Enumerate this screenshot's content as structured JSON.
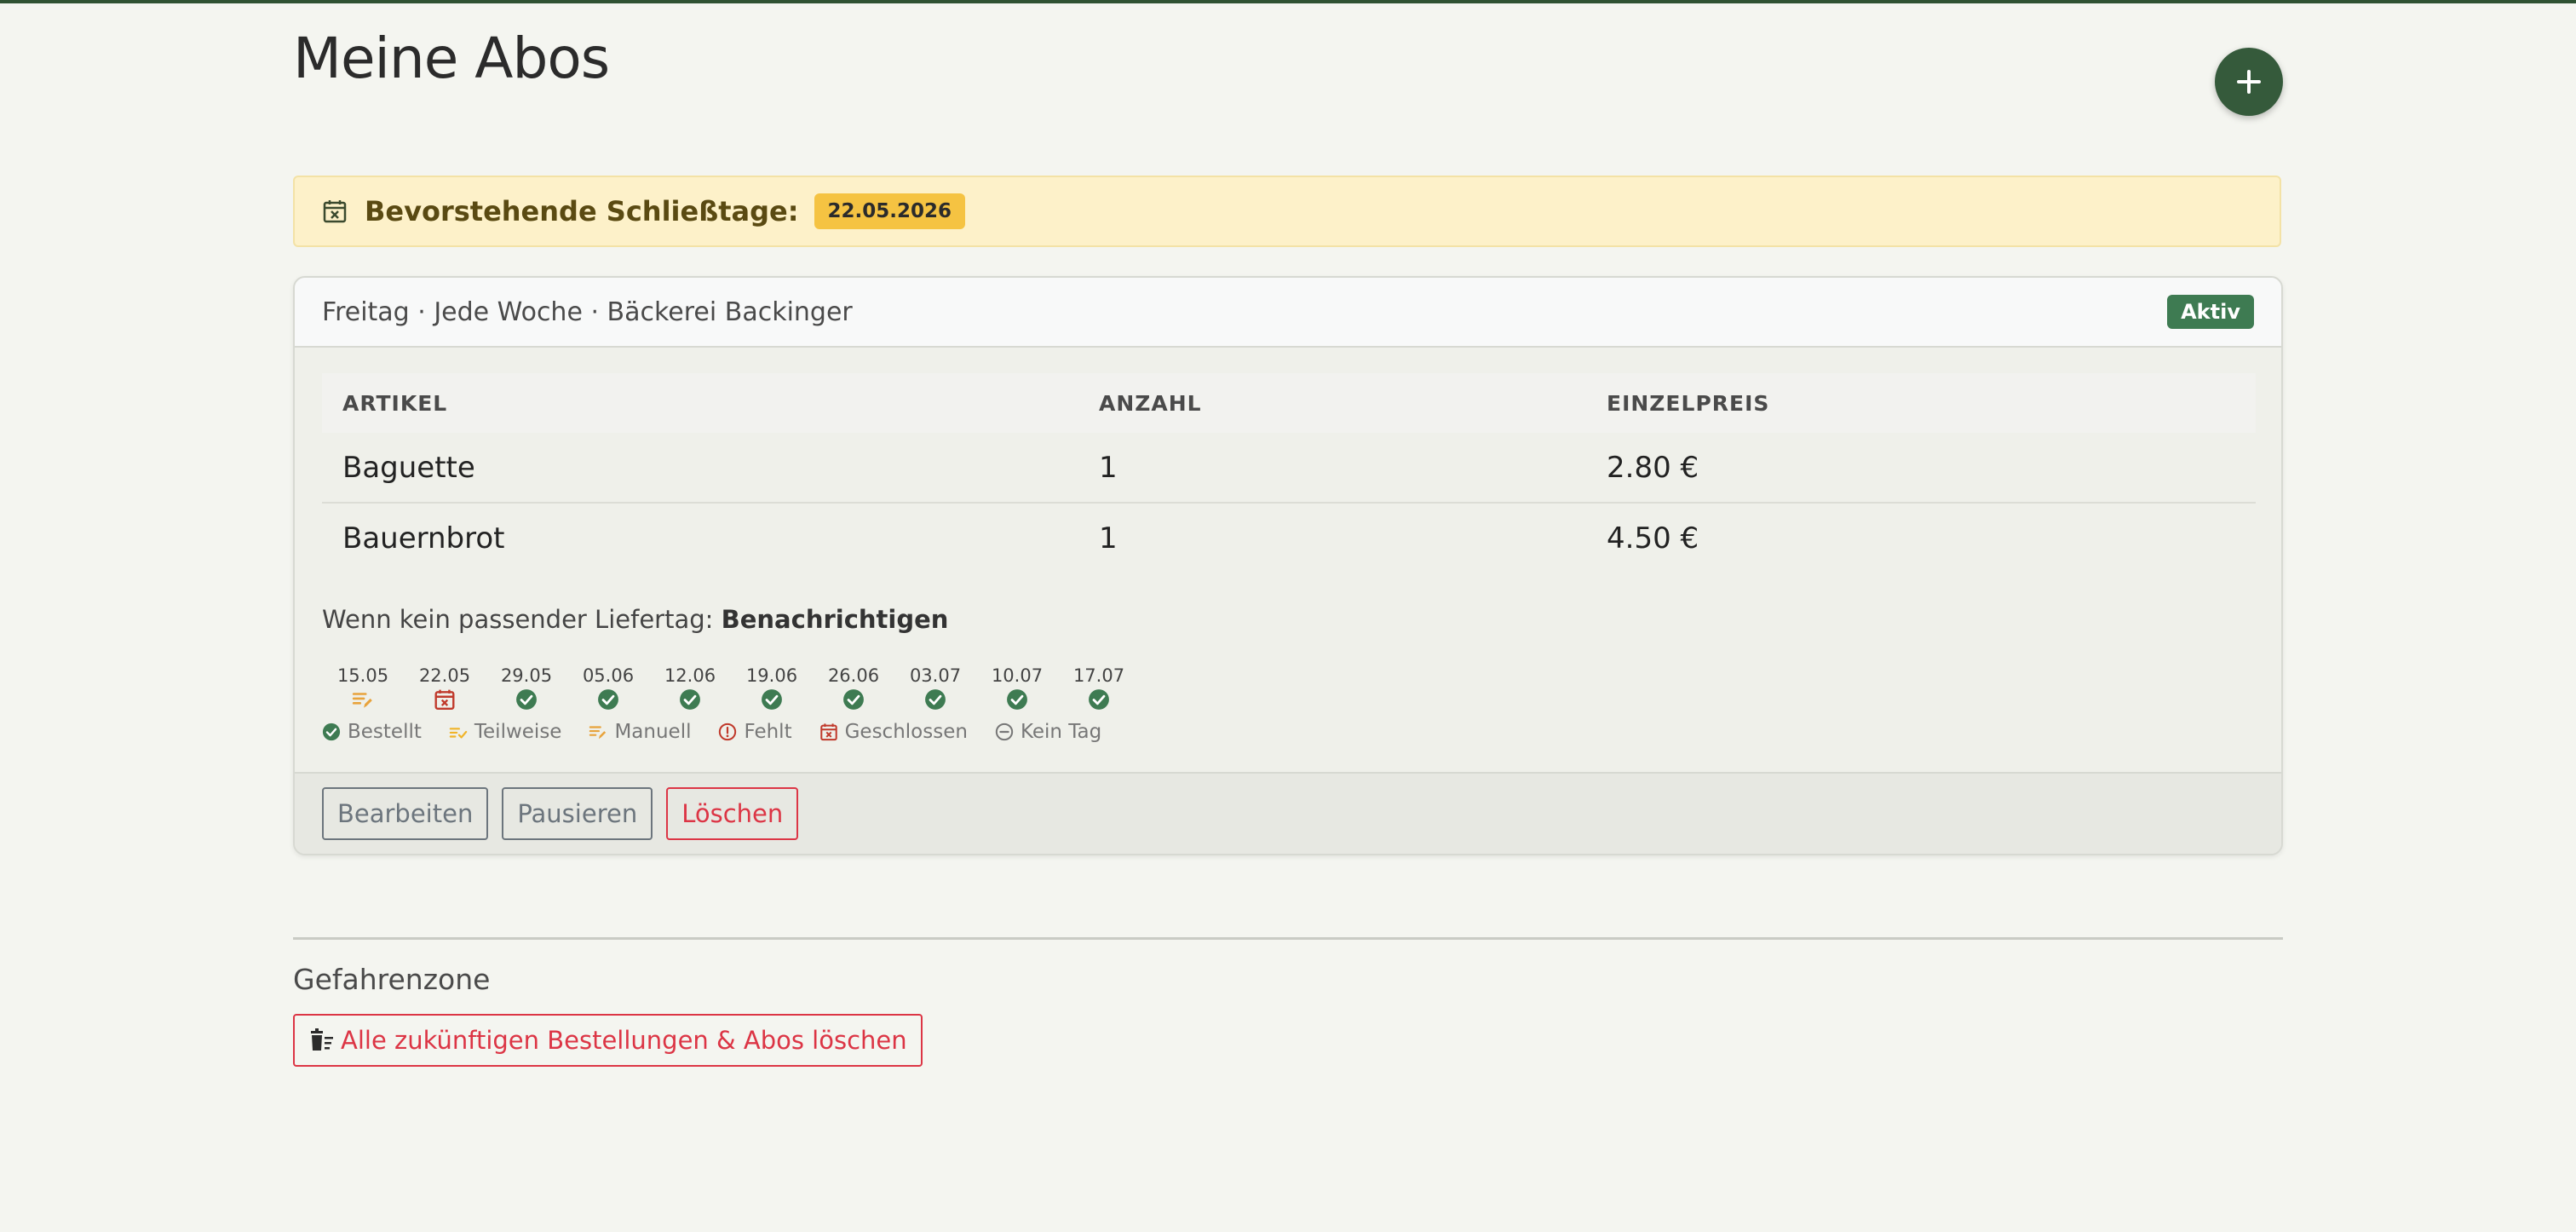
{
  "page": {
    "title": "Meine Abos"
  },
  "fab": {
    "icon": "plus-icon"
  },
  "closure": {
    "icon": "calendar-x-icon",
    "title": "Bevorstehende Schließtage:",
    "dates": [
      "22.05.2026"
    ]
  },
  "abo": {
    "summary": "Freitag · Jede Woche · Bäckerei Backinger",
    "status": "Aktiv",
    "table": {
      "headers": [
        "ARTIKEL",
        "ANZAHL",
        "EINZELPREIS"
      ],
      "rows": [
        {
          "item": "Baguette",
          "qty": "1",
          "price": "2.80 €"
        },
        {
          "item": "Bauernbrot",
          "qty": "1",
          "price": "4.50 €"
        }
      ]
    },
    "fallback": {
      "label": "Wenn kein passender Liefertag:",
      "value": "Benachrichtigen"
    },
    "timeline": [
      {
        "date": "15.05",
        "status": "manuell"
      },
      {
        "date": "22.05",
        "status": "geschlossen"
      },
      {
        "date": "29.05",
        "status": "bestellt"
      },
      {
        "date": "05.06",
        "status": "bestellt"
      },
      {
        "date": "12.06",
        "status": "bestellt"
      },
      {
        "date": "19.06",
        "status": "bestellt"
      },
      {
        "date": "26.06",
        "status": "bestellt"
      },
      {
        "date": "03.07",
        "status": "bestellt"
      },
      {
        "date": "10.07",
        "status": "bestellt"
      },
      {
        "date": "17.07",
        "status": "bestellt"
      }
    ],
    "legend": [
      {
        "key": "bestellt",
        "label": "Bestellt"
      },
      {
        "key": "teilweise",
        "label": "Teilweise"
      },
      {
        "key": "manuell",
        "label": "Manuell"
      },
      {
        "key": "fehlt",
        "label": "Fehlt"
      },
      {
        "key": "geschlossen",
        "label": "Geschlossen"
      },
      {
        "key": "keintag",
        "label": "Kein Tag"
      }
    ],
    "actions": {
      "edit": "Bearbeiten",
      "pause": "Pausieren",
      "delete": "Löschen"
    }
  },
  "danger": {
    "title": "Gefahrenzone",
    "delete_all": "Alle zukünftigen Bestellungen & Abos löschen"
  },
  "colors": {
    "primary": "#355a3b",
    "success": "#3e7b52",
    "warning": "#f5c342",
    "danger": "#dc3545",
    "secondary": "#6c757d"
  }
}
